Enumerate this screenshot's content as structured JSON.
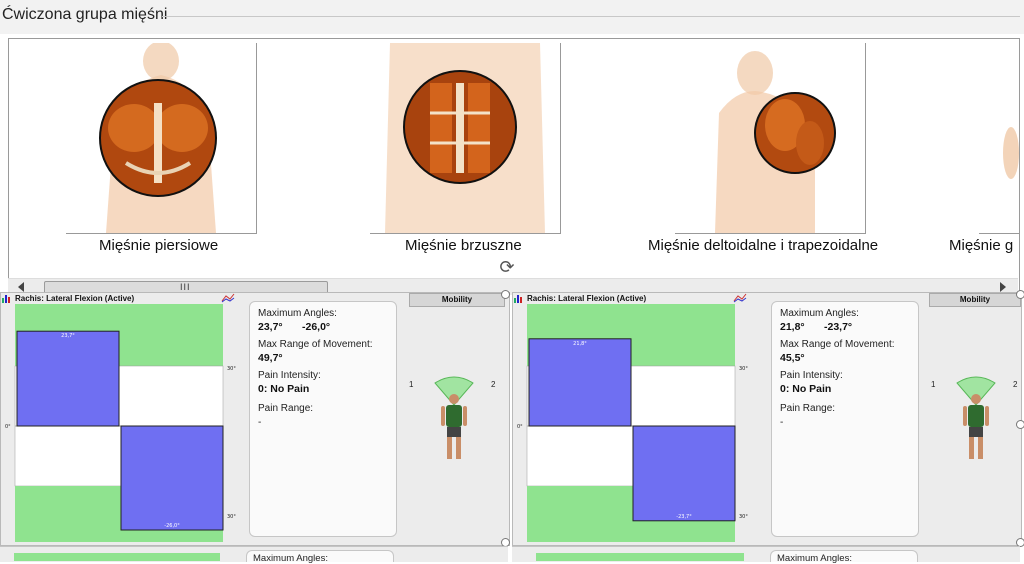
{
  "group": {
    "title": "Ćwiczona grupa mięśni"
  },
  "gallery": {
    "items": [
      {
        "label": "Mięśnie piersiowe"
      },
      {
        "label": "Mięśnie brzuszne"
      },
      {
        "label": "Mięśnie deltoidalne i trapezoidalne"
      },
      {
        "label": "Mięśnie g"
      }
    ],
    "scroll_grip": "III"
  },
  "panels": [
    {
      "title": "Rachis: Lateral Flexion (Active)",
      "tab": "Mobility",
      "chart": {
        "top_label": "23,7°",
        "bottom_label": "-26,0°",
        "axis_top": "30°",
        "axis_zero": "0°",
        "axis_bottom": "30°",
        "left_value": 23.7,
        "right_value": -26.0,
        "limit": 30
      },
      "info": {
        "max_angles_label": "Maximum Angles:",
        "max_angle_1": "23,7°",
        "max_angle_2": "-26,0°",
        "max_range_label": "Max Range of Movement:",
        "max_range_value": "49,7°",
        "pain_intensity_label": "Pain Intensity:",
        "pain_intensity_value": "0: No Pain",
        "pain_range_label": "Pain Range:",
        "pain_range_value": "-"
      },
      "side_left": "1",
      "side_right": "2"
    },
    {
      "title": "Rachis: Lateral Flexion (Active)",
      "tab": "Mobility",
      "chart": {
        "top_label": "21,8°",
        "bottom_label": "-23,7°",
        "axis_top": "30°",
        "axis_zero": "0°",
        "axis_bottom": "30°",
        "left_value": 21.8,
        "right_value": -23.7,
        "limit": 30
      },
      "info": {
        "max_angles_label": "Maximum Angles:",
        "max_angle_1": "21,8°",
        "max_angle_2": "-23,7°",
        "max_range_label": "Max Range of Movement:",
        "max_range_value": "45,5°",
        "pain_intensity_label": "Pain Intensity:",
        "pain_intensity_value": "0: No Pain",
        "pain_range_label": "Pain Range:",
        "pain_range_value": "-"
      },
      "side_left": "1",
      "side_right": "2"
    }
  ],
  "bottom": {
    "label_1": "Maximum Angles:",
    "label_2": "Maximum Angles:"
  },
  "colors": {
    "green": "#8fe38f",
    "blue": "#6f6ff2",
    "white": "#ffffff",
    "panel": "#ececec"
  }
}
